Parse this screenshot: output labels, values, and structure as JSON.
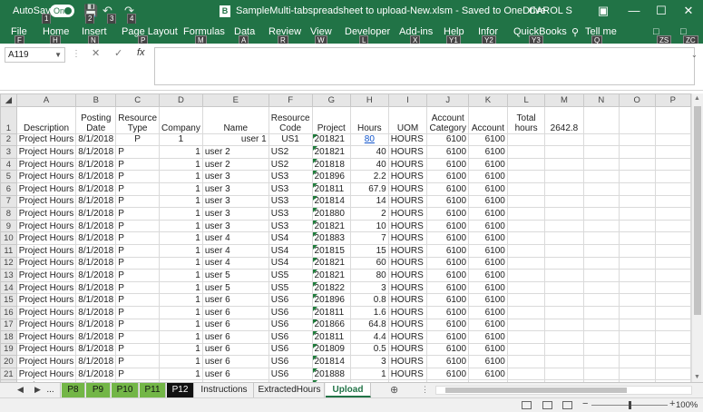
{
  "titlebar": {
    "autosave_label": "AutoSave",
    "autosave_state": "On",
    "doc_icon_letter": "B",
    "document_title": "SampleMulti-tabspreadsheet to upload-New.xlsm - Saved to OneDrive",
    "user": "CAROL S",
    "keytips": [
      "1",
      "2",
      "3",
      "4"
    ],
    "icons": [
      "save-icon",
      "undo-icon",
      "redo-icon",
      "ribbon-display-icon",
      "minimize-icon",
      "maximize-icon",
      "close-icon"
    ]
  },
  "ribbon": {
    "tabs": [
      {
        "label": "File",
        "keytip": "F"
      },
      {
        "label": "Home",
        "keytip": "H"
      },
      {
        "label": "Insert",
        "keytip": "N"
      },
      {
        "label": "Page Layout",
        "keytip": "P"
      },
      {
        "label": "Formulas",
        "keytip": "M"
      },
      {
        "label": "Data",
        "keytip": "A"
      },
      {
        "label": "Review",
        "keytip": "R"
      },
      {
        "label": "View",
        "keytip": "W"
      },
      {
        "label": "Developer",
        "keytip": "L"
      },
      {
        "label": "Add-ins",
        "keytip": "X"
      },
      {
        "label": "Help",
        "keytip": "Y1"
      },
      {
        "label": "Infor",
        "keytip": "Y2"
      },
      {
        "label": "QuickBooks",
        "keytip": "Y3"
      }
    ],
    "tell_me": "Tell me",
    "tell_me_keytip": "Q",
    "right_keytips": [
      "ZS",
      "ZC"
    ]
  },
  "formula_bar": {
    "name_box": "A119",
    "fx": "fx",
    "formula": ""
  },
  "columns": [
    "A",
    "B",
    "C",
    "D",
    "E",
    "F",
    "G",
    "H",
    "I",
    "J",
    "K",
    "L",
    "M",
    "N",
    "O",
    "P"
  ],
  "header_row": [
    "Description",
    "Posting Date",
    "Resource Type",
    "Company",
    "Name",
    "Resource Code",
    "Project",
    "Hours",
    "UOM",
    "Account Category",
    "Account",
    "Total hours",
    "2642.8",
    "",
    "",
    ""
  ],
  "rows": [
    {
      "n": "2",
      "cells": [
        "Project Hours",
        "8/1/2018",
        "P",
        "1",
        "user 1",
        "US1",
        "201821",
        "80",
        "HOURS",
        "6100",
        "6100"
      ]
    },
    {
      "n": "3",
      "cells": [
        "Project Hours",
        "8/1/2018",
        "P",
        "1",
        "user 2",
        "US2",
        "201821",
        "40",
        "HOURS",
        "6100",
        "6100"
      ]
    },
    {
      "n": "4",
      "cells": [
        "Project Hours",
        "8/1/2018",
        "P",
        "1",
        "user 2",
        "US2",
        "201818",
        "40",
        "HOURS",
        "6100",
        "6100"
      ]
    },
    {
      "n": "5",
      "cells": [
        "Project Hours",
        "8/1/2018",
        "P",
        "1",
        "user 3",
        "US3",
        "201896",
        "2.2",
        "HOURS",
        "6100",
        "6100"
      ]
    },
    {
      "n": "6",
      "cells": [
        "Project Hours",
        "8/1/2018",
        "P",
        "1",
        "user 3",
        "US3",
        "201811",
        "67.9",
        "HOURS",
        "6100",
        "6100"
      ]
    },
    {
      "n": "7",
      "cells": [
        "Project Hours",
        "8/1/2018",
        "P",
        "1",
        "user 3",
        "US3",
        "201814",
        "14",
        "HOURS",
        "6100",
        "6100"
      ]
    },
    {
      "n": "8",
      "cells": [
        "Project Hours",
        "8/1/2018",
        "P",
        "1",
        "user 3",
        "US3",
        "201880",
        "2",
        "HOURS",
        "6100",
        "6100"
      ]
    },
    {
      "n": "9",
      "cells": [
        "Project Hours",
        "8/1/2018",
        "P",
        "1",
        "user 3",
        "US3",
        "201821",
        "10",
        "HOURS",
        "6100",
        "6100"
      ]
    },
    {
      "n": "10",
      "cells": [
        "Project Hours",
        "8/1/2018",
        "P",
        "1",
        "user 4",
        "US4",
        "201883",
        "7",
        "HOURS",
        "6100",
        "6100"
      ]
    },
    {
      "n": "11",
      "cells": [
        "Project Hours",
        "8/1/2018",
        "P",
        "1",
        "user 4",
        "US4",
        "201815",
        "15",
        "HOURS",
        "6100",
        "6100"
      ]
    },
    {
      "n": "12",
      "cells": [
        "Project Hours",
        "8/1/2018",
        "P",
        "1",
        "user 4",
        "US4",
        "201821",
        "60",
        "HOURS",
        "6100",
        "6100"
      ]
    },
    {
      "n": "13",
      "cells": [
        "Project Hours",
        "8/1/2018",
        "P",
        "1",
        "user 5",
        "US5",
        "201821",
        "80",
        "HOURS",
        "6100",
        "6100"
      ]
    },
    {
      "n": "14",
      "cells": [
        "Project Hours",
        "8/1/2018",
        "P",
        "1",
        "user 5",
        "US5",
        "201822",
        "3",
        "HOURS",
        "6100",
        "6100"
      ]
    },
    {
      "n": "15",
      "cells": [
        "Project Hours",
        "8/1/2018",
        "P",
        "1",
        "user 6",
        "US6",
        "201896",
        "0.8",
        "HOURS",
        "6100",
        "6100"
      ]
    },
    {
      "n": "16",
      "cells": [
        "Project Hours",
        "8/1/2018",
        "P",
        "1",
        "user 6",
        "US6",
        "201811",
        "1.6",
        "HOURS",
        "6100",
        "6100"
      ]
    },
    {
      "n": "17",
      "cells": [
        "Project Hours",
        "8/1/2018",
        "P",
        "1",
        "user 6",
        "US6",
        "201866",
        "64.8",
        "HOURS",
        "6100",
        "6100"
      ]
    },
    {
      "n": "18",
      "cells": [
        "Project Hours",
        "8/1/2018",
        "P",
        "1",
        "user 6",
        "US6",
        "201811",
        "4.4",
        "HOURS",
        "6100",
        "6100"
      ]
    },
    {
      "n": "19",
      "cells": [
        "Project Hours",
        "8/1/2018",
        "P",
        "1",
        "user 6",
        "US6",
        "201809",
        "0.5",
        "HOURS",
        "6100",
        "6100"
      ]
    },
    {
      "n": "20",
      "cells": [
        "Project Hours",
        "8/1/2018",
        "P",
        "1",
        "user 6",
        "US6",
        "201814",
        "3",
        "HOURS",
        "6100",
        "6100"
      ]
    },
    {
      "n": "21",
      "cells": [
        "Project Hours",
        "8/1/2018",
        "P",
        "1",
        "user 6",
        "US6",
        "201888",
        "1",
        "HOURS",
        "6100",
        "6100"
      ]
    },
    {
      "n": "22",
      "cells": [
        "Project Hours",
        "8/1/2018",
        "P",
        "1",
        "user 6",
        "US6",
        "",
        "",
        "",
        "",
        ""
      ]
    }
  ],
  "sheet_tabs": [
    {
      "label": "...",
      "style": "plain"
    },
    {
      "label": "P8",
      "style": "green"
    },
    {
      "label": "P9",
      "style": "green"
    },
    {
      "label": "P10",
      "style": "green"
    },
    {
      "label": "P11",
      "style": "green"
    },
    {
      "label": "P12",
      "style": "black"
    },
    {
      "label": "Instructions",
      "style": "plain"
    },
    {
      "label": "ExtractedHours",
      "style": "plain"
    },
    {
      "label": "Upload",
      "style": "active"
    }
  ],
  "status": {
    "zoom": "100%"
  },
  "colors": {
    "excel_green": "#217346",
    "tab_green": "#73b647",
    "tab_black": "#111111",
    "hyperlink": "#1155cc"
  }
}
